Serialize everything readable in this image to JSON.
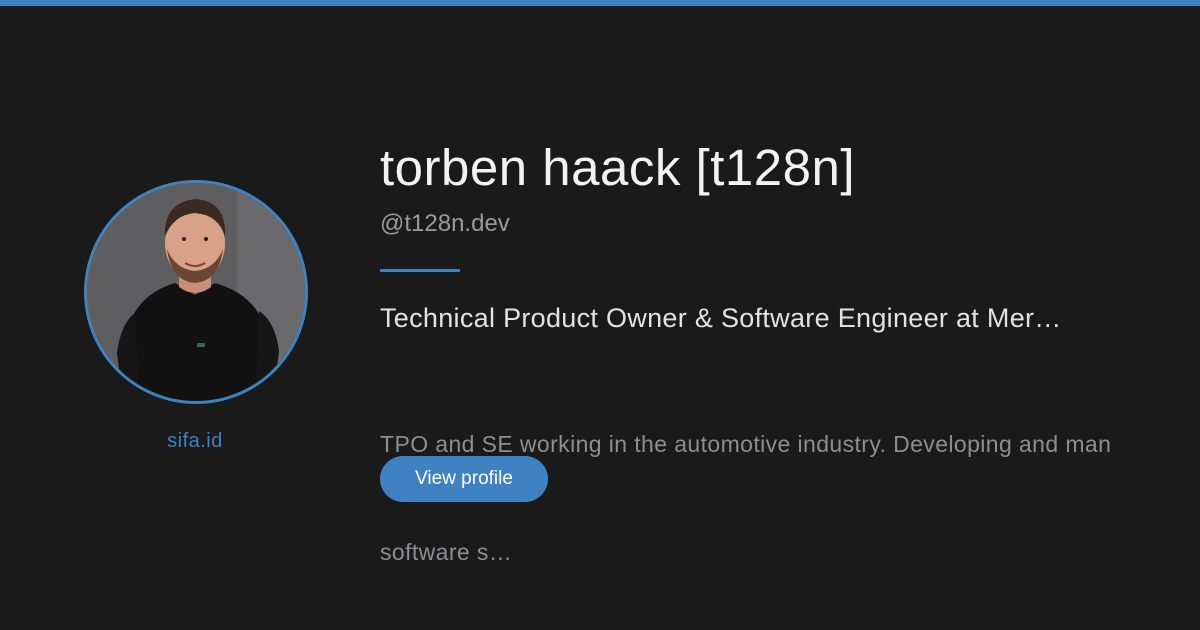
{
  "profile": {
    "name": "torben haack [t128n]",
    "handle": "@t128n.dev",
    "headline": "Technical Product Owner & Software Engineer at Mer…",
    "bio_line1": "TPO and SE working in the automotive industry. Developing and man",
    "bio_line2": "software s…",
    "view_button_label": "View profile",
    "avatar_alt": "Profile photo of torben haack"
  },
  "brand": {
    "label": "sifa.id"
  },
  "colors": {
    "accent": "#3f82c2",
    "background": "#1a1a1b"
  },
  "icons": {
    "avatar": "avatar-photo"
  }
}
